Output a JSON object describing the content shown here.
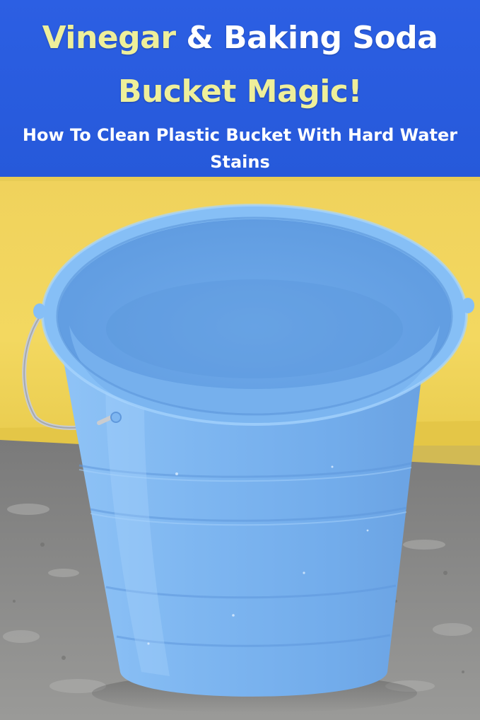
{
  "pin": {
    "title_line1_part1": "Vinegar",
    "title_line1_part2": "& Baking Soda",
    "title_line2": "Bucket Magic!",
    "subtitle": "How To Clean Plastic Bucket With Hard Water Stains"
  },
  "colors": {
    "banner": "#2a5de0",
    "title_accent": "#eeef9a",
    "title_white": "#ffffff",
    "wall": "#f2d45a",
    "bucket": "#7fb6f0",
    "floor": "#8c8c8c"
  },
  "photo": {
    "subject": "blue-plastic-bucket"
  }
}
